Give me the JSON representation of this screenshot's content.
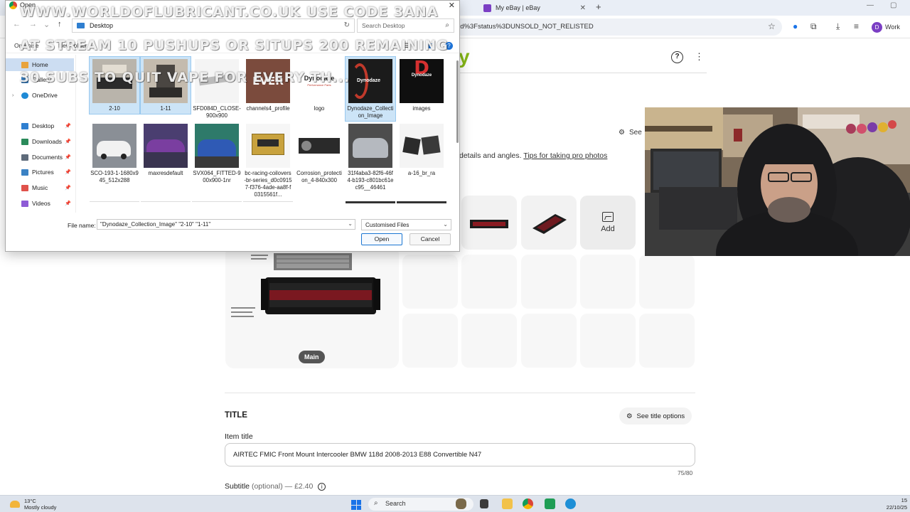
{
  "browser": {
    "tabs": [
      {
        "label": "My eBay | eBay"
      }
    ],
    "new_tab": "+",
    "url": "ed%3Fstatus%3DUNSOLD_NOT_RELISTED",
    "profile_initial": "D",
    "profile_label": "Work"
  },
  "ebay": {
    "logo": "y",
    "help_icon": "?",
    "more_icon": "⋮",
    "see_photo_options": "See",
    "photo_hint_text": "details and angles. ",
    "photo_hint_link": "Tips for taking pro photos",
    "add_label": "Add",
    "main_badge": "Main",
    "title_section": {
      "heading": "TITLE",
      "see_options": "See title options",
      "item_title_label": "Item title",
      "item_title_value": "AIRTEC FMIC Front Mount Intercooler BMW 118d 2008-2013 E88 Convertible N47",
      "counter": "75/80",
      "subtitle_label": "Subtitle",
      "subtitle_optional": "(optional)",
      "subtitle_price": " — £2.40",
      "info_icon": "i"
    }
  },
  "dialog": {
    "title": "Open",
    "path": "Desktop",
    "search_placeholder": "Search Desktop",
    "organise": "Organise",
    "new_folder": "New folder",
    "nav": [
      {
        "label": "Home",
        "icon": "home-icon",
        "color": "#e8a33d"
      },
      {
        "label": "Gallery",
        "icon": "gallery-icon",
        "color": "#3b82c4"
      },
      {
        "label": "OneDrive",
        "icon": "cloud-icon",
        "color": "#1f8ad6"
      },
      {
        "label": "Desktop",
        "icon": "desktop-icon",
        "color": "#2f7fd0"
      },
      {
        "label": "Downloads",
        "icon": "download-icon",
        "color": "#2a8a5a"
      },
      {
        "label": "Documents",
        "icon": "documents-icon",
        "color": "#5e6b7a"
      },
      {
        "label": "Pictures",
        "icon": "pictures-icon",
        "color": "#3b82c4"
      },
      {
        "label": "Music",
        "icon": "music-icon",
        "color": "#e0524b"
      },
      {
        "label": "Videos",
        "icon": "videos-icon",
        "color": "#8e5bd6"
      }
    ],
    "files": [
      {
        "label": "2-10"
      },
      {
        "label": "1-11"
      },
      {
        "label": "SFD084D_CLOSE-900x900"
      },
      {
        "label": "channels4_profile"
      },
      {
        "label": "logo"
      },
      {
        "label": "Dynodaze_Collection_Image"
      },
      {
        "label": "images"
      },
      {
        "label": "SCO-193-1-1680x945_512x288"
      },
      {
        "label": "maxresdefault"
      },
      {
        "label": "SVX064_FITTED-900x900-1nr"
      },
      {
        "label": "bc-racing-coilovers-br-series_d0c09157-f376-4ade-aa8f-f0315561f..."
      },
      {
        "label": "Corrosion_protection_4-840x300"
      },
      {
        "label": "31f4aba3-82f6-46f4-b193-c801bc61ec95__46461"
      },
      {
        "label": "a-16_br_ra"
      }
    ],
    "thumb_texts": {
      "channels4": "EVER",
      "logo": "Dynodaze",
      "logo_sub": "Performance Parts",
      "collection": "Dynodaze",
      "images_letter": "D",
      "images_name": "Dynodaze"
    },
    "filename_label": "File name:",
    "filename_value": "\"Dynodaze_Collection_Image\" \"2-10\" \"1-11\"",
    "filetype": "Customised Files",
    "open_button": "Open",
    "cancel_button": "Cancel"
  },
  "captions": [
    "WWW.WORLDOFLUBRICANT.CO.UK USE CODE 3ANA",
    "AT STREAM 10 PUSHUPS OR SITUPS 200 REMAINING",
    "30 SUBS TO QUIT VAPE FOR EVERY TH..."
  ],
  "taskbar": {
    "temperature": "13°C",
    "weather": "Mostly cloudy",
    "search_label": "Search",
    "time": "15",
    "date": "22/10/25"
  },
  "colors": {
    "ebay_green": "#86b817",
    "selection_blue": "#cce4f7",
    "primary_blue": "#1b76d2"
  }
}
